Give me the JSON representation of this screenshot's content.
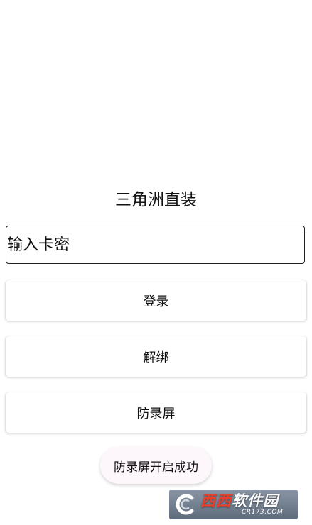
{
  "app": {
    "title": "三角洲直装"
  },
  "login_form": {
    "card_input_placeholder": "输入卡密",
    "card_input_value": ""
  },
  "buttons": {
    "login_label": "登录",
    "unbind_label": "解绑",
    "anti_record_label": "防录屏"
  },
  "toast": {
    "message": "防录屏开启成功"
  },
  "watermark": {
    "brand_part1": "西西",
    "brand_part2": "软件园",
    "domain": "CR173.COM",
    "icon": "c-logo-icon"
  },
  "colors": {
    "background": "#ffffff",
    "text": "#111111",
    "toast_bg": "#fdf7fb",
    "watermark_accent": "#e8402a"
  }
}
